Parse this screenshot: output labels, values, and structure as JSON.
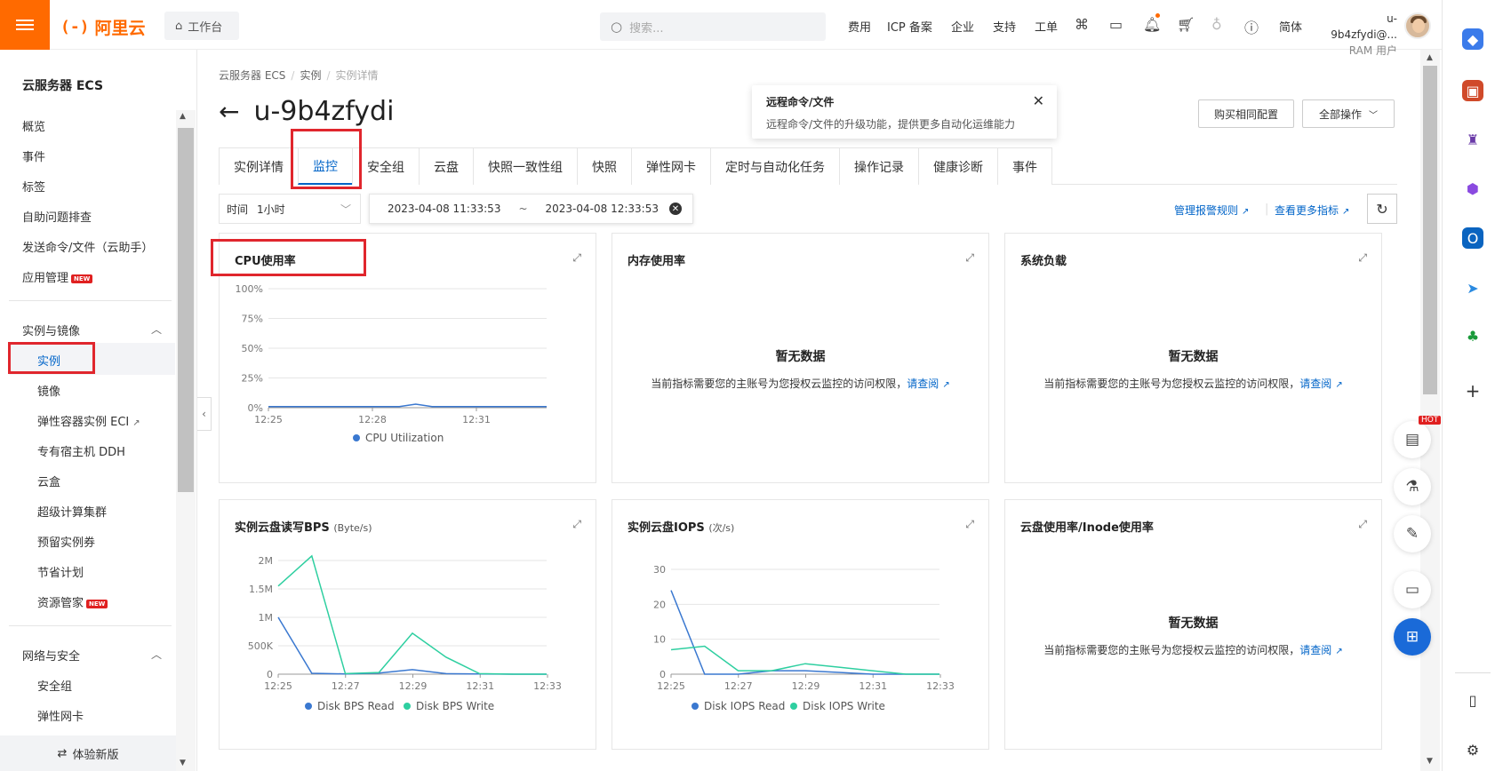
{
  "topbar": {
    "brand": "阿里云",
    "workbench": "工作台",
    "search_placeholder": "搜索...",
    "nav": [
      "费用",
      "ICP 备案",
      "企业",
      "支持",
      "工单"
    ],
    "lang": "简体",
    "user_name": "u-9b4zfydi@...",
    "user_role": "RAM 用户"
  },
  "sidebar": {
    "title": "云服务器 ECS",
    "items": [
      "概览",
      "事件",
      "标签",
      "自助问题排查",
      "发送命令/文件（云助手）",
      "应用管理"
    ],
    "new_badge": "NEW",
    "group1": "实例与镜像",
    "group1_items": [
      "实例",
      "镜像",
      "弹性容器实例 ECI",
      "专有宿主机 DDH",
      "云盒",
      "超级计算集群",
      "预留实例券",
      "节省计划",
      "资源管家"
    ],
    "group2": "网络与安全",
    "group2_items": [
      "安全组",
      "弹性网卡"
    ],
    "bottom": "体验新版"
  },
  "breadcrumb": [
    "云服务器 ECS",
    "实例",
    "实例详情"
  ],
  "page_title": "u-9b4zfydi",
  "tooltip": {
    "title": "远程命令/文件",
    "desc": "远程命令/文件的升级功能，提供更多自动化运维能力"
  },
  "buttons": {
    "buy": "购买相同配置",
    "all_ops": "全部操作"
  },
  "tabs": [
    "实例详情",
    "监控",
    "安全组",
    "云盘",
    "快照一致性组",
    "快照",
    "弹性网卡",
    "定时与自动化任务",
    "操作记录",
    "健康诊断",
    "事件"
  ],
  "active_tab": "监控",
  "filters": {
    "time_label": "时间",
    "time_value": "1小时",
    "start": "2023-04-08 11:33:53",
    "sep": "~",
    "end": "2023-04-08 12:33:53",
    "link_alarm": "管理报警规则",
    "link_more": "查看更多指标"
  },
  "cards": {
    "cpu": {
      "title": "CPU使用率",
      "legend": "CPU Utilization"
    },
    "mem": {
      "title": "内存使用率"
    },
    "load": {
      "title": "系统负载"
    },
    "bps": {
      "title": "实例云盘读写BPS",
      "unit": "(Byte/s)",
      "legend_read": "Disk BPS Read",
      "legend_write": "Disk BPS Write"
    },
    "iops": {
      "title": "实例云盘IOPS",
      "unit": "(次/s)",
      "legend_read": "Disk IOPS Read",
      "legend_write": "Disk IOPS Write"
    },
    "disk": {
      "title": "云盘使用率/Inode使用率"
    },
    "no_data": "暂无数据",
    "no_data_desc": "当前指标需要您的主账号为您授权云监控的访问权限，",
    "no_data_link": "请查阅"
  },
  "hot_badge": "HOT",
  "colors": {
    "brand": "#ff6a00",
    "accent": "#0064c8",
    "highlight": "#e0262d",
    "series_blue": "#3a78d0",
    "series_green": "#2ecfa0"
  },
  "chart_data": [
    {
      "type": "line",
      "title": "CPU使用率",
      "x_ticks": [
        "12:25",
        "12:28",
        "12:31"
      ],
      "y_ticks": [
        "0%",
        "25%",
        "50%",
        "75%",
        "100%"
      ],
      "ylim": [
        0,
        100
      ],
      "series": [
        {
          "name": "CPU Utilization",
          "values": [
            1,
            1,
            1,
            1,
            1,
            1,
            1,
            1,
            1,
            3,
            1,
            1,
            1,
            1,
            1,
            1,
            1,
            1
          ]
        }
      ]
    },
    {
      "type": "line",
      "title": "实例云盘读写BPS",
      "x_ticks": [
        "12:25",
        "12:27",
        "12:29",
        "12:31",
        "12:33"
      ],
      "y_ticks": [
        "0",
        "500K",
        "1M",
        "1.5M",
        "2M"
      ],
      "ylim": [
        0,
        2000000
      ],
      "series": [
        {
          "name": "Disk BPS Read",
          "values": [
            1000000,
            15000,
            5000,
            20000,
            80000,
            10000,
            5000,
            0,
            0
          ]
        },
        {
          "name": "Disk BPS Write",
          "values": [
            1550000,
            2080000,
            10000,
            30000,
            720000,
            300000,
            10000,
            0,
            0
          ]
        }
      ]
    },
    {
      "type": "line",
      "title": "实例云盘IOPS",
      "x_ticks": [
        "12:25",
        "12:27",
        "12:29",
        "12:31",
        "12:33"
      ],
      "y_ticks": [
        "0",
        "10",
        "20",
        "30"
      ],
      "ylim": [
        0,
        30
      ],
      "series": [
        {
          "name": "Disk IOPS Read",
          "values": [
            24,
            0,
            0,
            1,
            1,
            0.5,
            0,
            0,
            0
          ]
        },
        {
          "name": "Disk IOPS Write",
          "values": [
            7,
            8,
            1,
            1,
            3,
            2,
            1,
            0,
            0
          ]
        }
      ]
    }
  ]
}
